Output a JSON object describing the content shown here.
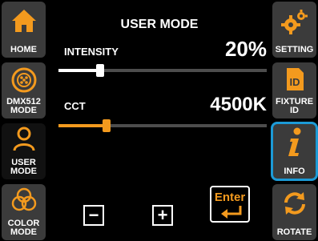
{
  "colors": {
    "accent": "#f39a1e",
    "highlight": "#1c9ad6",
    "panel": "#3b3b3b",
    "track": "#4d4d4d"
  },
  "left_nav": [
    {
      "label": "HOME",
      "icon": "home-icon"
    },
    {
      "label": "DMX512\nMODE",
      "icon": "dmx-connector-icon"
    },
    {
      "label": "USER\nMODE",
      "icon": "user-icon"
    },
    {
      "label": "COLOR\nMODE",
      "icon": "color-circles-icon"
    }
  ],
  "right_nav": [
    {
      "label": "SETTING",
      "icon": "gears-icon"
    },
    {
      "label": "FIXTURE\nID",
      "icon": "id-icon"
    },
    {
      "label": "INFO",
      "icon": "info-icon"
    },
    {
      "label": "ROTATE",
      "icon": "rotate-icon"
    }
  ],
  "main": {
    "title": "USER MODE",
    "intensity": {
      "label": "INTENSITY",
      "value": "20%",
      "level": 0.2
    },
    "cct": {
      "label": "CCT",
      "value": "4500K",
      "level": 0.23
    },
    "minus_label": "−",
    "plus_label": "+",
    "enter_label": "Enter"
  }
}
